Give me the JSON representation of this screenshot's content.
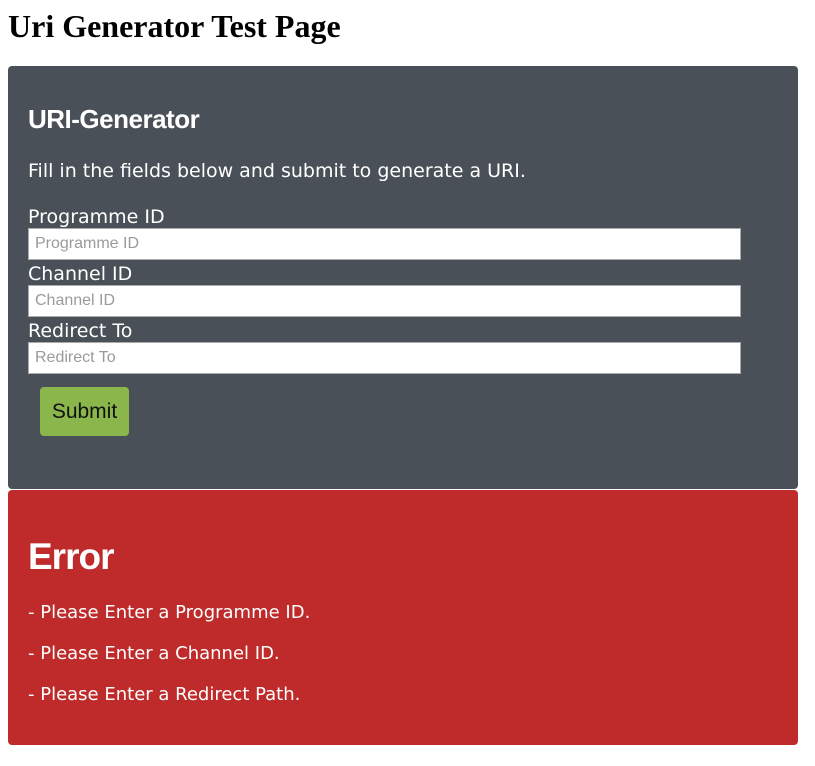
{
  "page_title": "Uri Generator Test Page",
  "generator": {
    "title": "URI-Generator",
    "intro": "Fill in the fields below and submit to generate a URI.",
    "fields": [
      {
        "label": "Programme ID",
        "placeholder": "Programme ID",
        "value": ""
      },
      {
        "label": "Channel ID",
        "placeholder": "Channel ID",
        "value": ""
      },
      {
        "label": "Redirect To",
        "placeholder": "Redirect To",
        "value": ""
      }
    ],
    "submit_label": "Submit"
  },
  "error": {
    "title": "Error",
    "messages": [
      "- Please Enter a Programme ID.",
      "- Please Enter a Channel ID.",
      "- Please Enter a Redirect Path."
    ]
  },
  "colors": {
    "form_panel_bg": "#495057",
    "error_panel_bg": "#bf2a2a",
    "submit_bg": "#8ab64b",
    "panel_text": "#ffffff"
  }
}
